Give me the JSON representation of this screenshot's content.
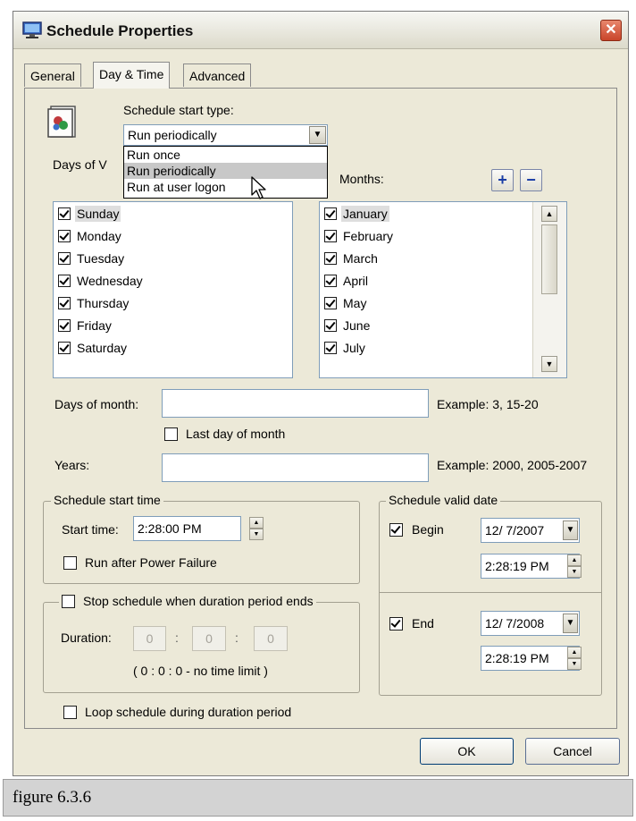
{
  "window": {
    "title": "Schedule Properties",
    "close_glyph": "✕"
  },
  "tabs": [
    {
      "label": "General",
      "active": false
    },
    {
      "label": "Day & Time",
      "active": true
    },
    {
      "label": "Advanced",
      "active": false
    }
  ],
  "start_type": {
    "label": "Schedule start type:",
    "value": "Run periodically",
    "options": [
      "Run once",
      "Run periodically",
      "Run at user logon"
    ],
    "highlighted": "Run periodically"
  },
  "days_of_week": {
    "label_partial": "Days of V",
    "items": [
      {
        "label": "Sunday",
        "checked": true
      },
      {
        "label": "Monday",
        "checked": true
      },
      {
        "label": "Tuesday",
        "checked": true
      },
      {
        "label": "Wednesday",
        "checked": true
      },
      {
        "label": "Thursday",
        "checked": true
      },
      {
        "label": "Friday",
        "checked": true
      },
      {
        "label": "Saturday",
        "checked": true
      }
    ]
  },
  "months": {
    "label": "Months:",
    "add_glyph": "+",
    "remove_glyph": "−",
    "items": [
      {
        "label": "January",
        "checked": true
      },
      {
        "label": "February",
        "checked": true
      },
      {
        "label": "March",
        "checked": true
      },
      {
        "label": "April",
        "checked": true
      },
      {
        "label": "May",
        "checked": true
      },
      {
        "label": "June",
        "checked": true
      },
      {
        "label": "July",
        "checked": true
      }
    ]
  },
  "days_of_month": {
    "label": "Days of month:",
    "value": "",
    "example": "Example: 3, 15-20",
    "last_day_label": "Last day of month",
    "last_day_checked": false
  },
  "years": {
    "label": "Years:",
    "value": "",
    "example": "Example: 2000, 2005-2007"
  },
  "start_time_group": {
    "title": "Schedule start time",
    "start_time_label": "Start time:",
    "start_time_value": "2:28:00 PM",
    "power_failure_label": "Run after Power Failure",
    "power_failure_checked": false
  },
  "duration_group": {
    "stop_label": "Stop schedule when duration period ends",
    "stop_checked": false,
    "duration_label": "Duration:",
    "hours": "0",
    "minutes": "0",
    "seconds": "0",
    "separator": ":",
    "summary": "( 0 : 0 : 0 - no time limit )"
  },
  "loop_label": "Loop schedule during duration period",
  "loop_checked": false,
  "valid_date_group": {
    "title": "Schedule valid date",
    "begin_label": "Begin",
    "begin_checked": true,
    "begin_date": "12/ 7/2007",
    "begin_time": "2:28:19 PM",
    "end_label": "End",
    "end_checked": true,
    "end_date": "12/ 7/2008",
    "end_time": "2:28:19 PM"
  },
  "buttons": {
    "ok": "OK",
    "cancel": "Cancel"
  },
  "icons": {
    "combo_arrow": "▼",
    "scroll_up": "▲",
    "scroll_down": "▼",
    "spin_up": "▲",
    "spin_down": "▼"
  },
  "figure_caption": "figure 6.3.6"
}
